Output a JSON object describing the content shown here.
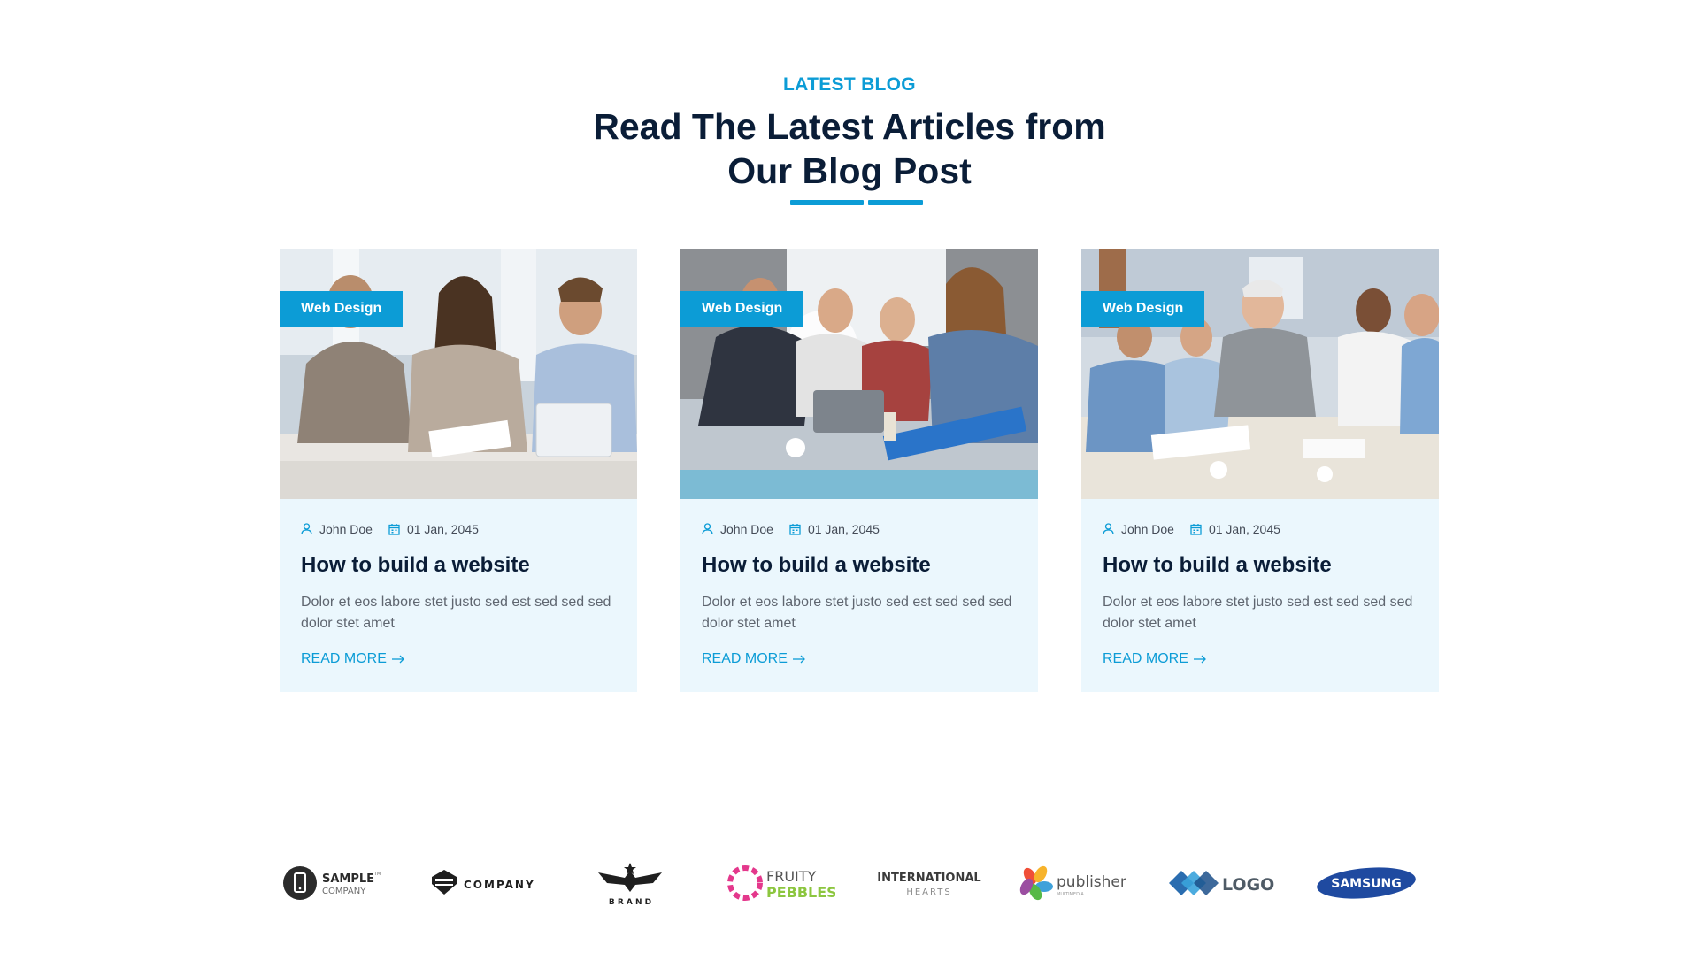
{
  "section": {
    "eyebrow": "LATEST BLOG",
    "heading_line1": "Read The Latest Articles from",
    "heading_line2": "Our Blog Post"
  },
  "colors": {
    "accent": "#0c9cd6",
    "heading": "#0a1d37",
    "card_bg": "#ebf7fd",
    "body_text": "#5f6670"
  },
  "posts": [
    {
      "category": "Web Design",
      "author": "John Doe",
      "date": "01 Jan, 2045",
      "title": "How to build a website",
      "excerpt": "Dolor et eos labore stet justo sed est sed sed sed dolor stet amet",
      "link_label": "READ MORE",
      "image": "business-meeting-photo"
    },
    {
      "category": "Web Design",
      "author": "John Doe",
      "date": "01 Jan, 2045",
      "title": "How to build a website",
      "excerpt": "Dolor et eos labore stet justo sed est sed sed sed dolor stet amet",
      "link_label": "READ MORE",
      "image": "team-collaboration-photo"
    },
    {
      "category": "Web Design",
      "author": "John Doe",
      "date": "01 Jan, 2045",
      "title": "How to build a website",
      "excerpt": "Dolor et eos labore stet justo sed est sed sed sed dolor stet amet",
      "link_label": "READ MORE",
      "image": "conference-table-photo"
    }
  ],
  "icons": {
    "author": "user-icon",
    "date": "calendar-icon",
    "link": "arrow-right-icon"
  },
  "brand_logos": [
    {
      "line1": "SAMPLE",
      "line2": "COMPANY",
      "tm": "TM"
    },
    {
      "line1": "COMPANY"
    },
    {
      "line1": "B R A N D"
    },
    {
      "line1": "FRUITY",
      "line2": "PEBBLES"
    },
    {
      "line1": "INTERNATIONAL",
      "line2": "HEARTS"
    },
    {
      "line1": "publisher",
      "line2": "MULTIMEDIA"
    },
    {
      "line1": "LOGO"
    },
    {
      "line1": "SAMSUNG"
    }
  ]
}
